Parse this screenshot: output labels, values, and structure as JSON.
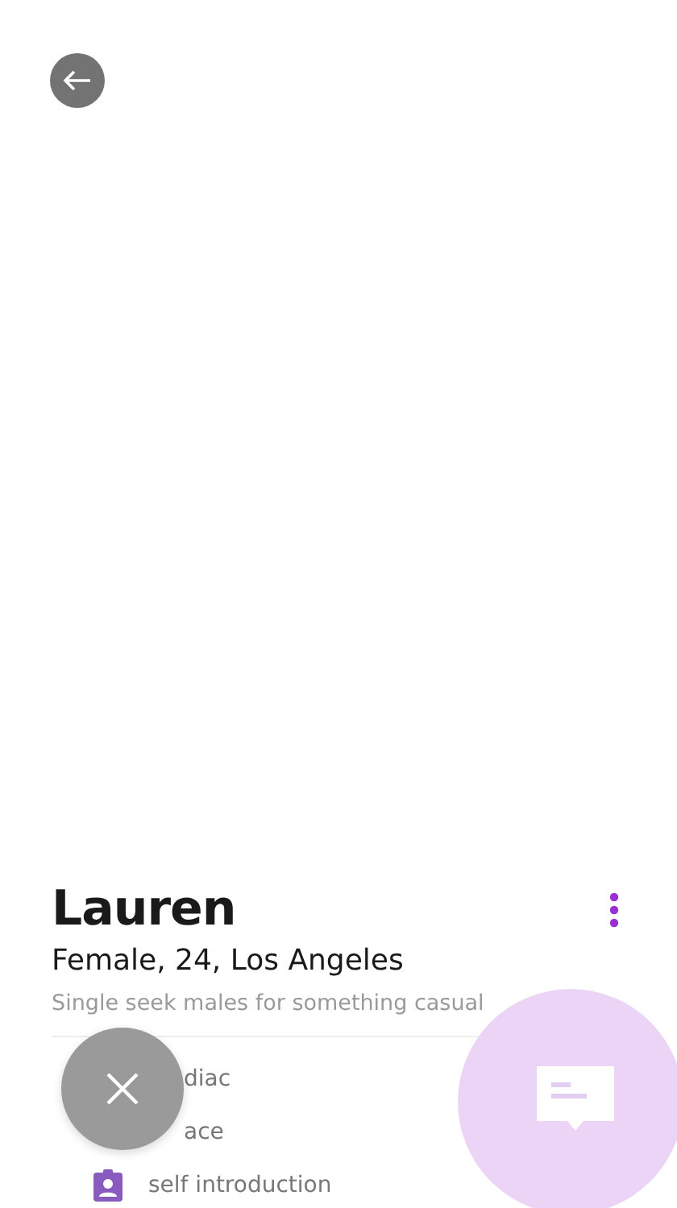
{
  "profile": {
    "name": "Lauren",
    "info": "Female, 24, Los Angeles",
    "tagline": "Single seek males for something casual"
  },
  "details": [
    {
      "kind": "covered",
      "label": "diac"
    },
    {
      "kind": "covered",
      "label": "ace"
    },
    {
      "kind": "badge",
      "label": "self introduction"
    }
  ]
}
